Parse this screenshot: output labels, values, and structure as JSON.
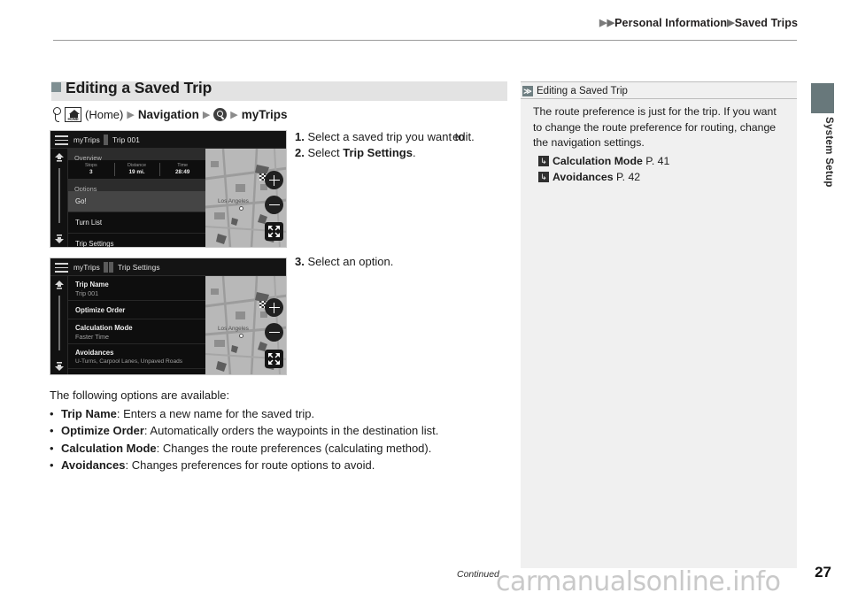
{
  "header": {
    "breadcrumb_1": "Personal Information",
    "breadcrumb_2": "Saved Trips",
    "arrow_glyph": "▶"
  },
  "side_tab": {
    "label": "System Setup"
  },
  "section": {
    "title": "Editing a Saved Trip"
  },
  "nav_path": {
    "home_label": "HOME",
    "home_text": "(Home)",
    "navigation": "Navigation",
    "search_icon": "search-icon",
    "mytrips": "myTrips",
    "arrow_glyph": "▶"
  },
  "device_1": {
    "title_a": "myTrips",
    "title_b": "Trip 001",
    "list_header": "Overview",
    "stats": [
      {
        "label": "Stops",
        "value": "3"
      },
      {
        "label": "Distance",
        "value": "19 mi."
      },
      {
        "label": "Time",
        "value": "28:49"
      }
    ],
    "options_header": "Options",
    "rows": [
      {
        "label": "Go!",
        "highlight": true
      },
      {
        "label": "Turn List",
        "highlight": false
      },
      {
        "label": "Trip Settings",
        "highlight": false
      }
    ],
    "map_city": "Los Angeles"
  },
  "device_2": {
    "title_a": "myTrips",
    "title_b": "Trip Settings",
    "rows": [
      {
        "label": "Trip Name",
        "sub": "Trip 001"
      },
      {
        "label": "Optimize Order",
        "sub": ""
      },
      {
        "label": "Calculation Mode",
        "sub": "Faster Time"
      },
      {
        "label": "Avoidances",
        "sub": "U-Turns, Carpool Lanes, Unpaved Roads"
      }
    ],
    "map_city": "Los Angeles"
  },
  "steps_a": {
    "step1_num": "1.",
    "step1_text": "Select a saved trip you want to",
    "step1_text2": "edit.",
    "step2_num": "2.",
    "step2_pre": "Select ",
    "step2_bold": "Trip Settings",
    "step2_post": "."
  },
  "steps_b": {
    "step3_num": "3.",
    "step3_text": "Select an option."
  },
  "prose": {
    "lead": "The following options are available:",
    "bullets": [
      {
        "dot": "•",
        "term": "Trip Name",
        "desc": ": Enters a new name for the saved trip."
      },
      {
        "dot": "•",
        "term": "Optimize Order",
        "desc": ": Automatically orders the waypoints in the destination list."
      },
      {
        "dot": "•",
        "term": "Calculation Mode",
        "desc": ": Changes the route preferences (calculating method)."
      },
      {
        "dot": "•",
        "term": "Avoidances",
        "desc": ": Changes preferences for route options to avoid."
      }
    ]
  },
  "note": {
    "chev_glyph": "≫",
    "title": "Editing a Saved Trip",
    "body": "The route preference is just for the trip. If you want to change the route preference for routing, change the navigation settings.",
    "refs": [
      {
        "arrow": "↳",
        "term": "Calculation Mode",
        "page": " P. 41"
      },
      {
        "arrow": "↳",
        "term": "Avoidances",
        "page": " P. 42"
      }
    ]
  },
  "footer": {
    "continued": "Continued",
    "page_number": "27",
    "watermark": "carmanualsonline.info"
  },
  "colors": {
    "section_bar": "#e3e3e3",
    "square_bullet": "#7f8f92",
    "side_tab": "#68787b",
    "note_bg": "#f0f0f0",
    "device_bg": "#0b0b0b"
  }
}
